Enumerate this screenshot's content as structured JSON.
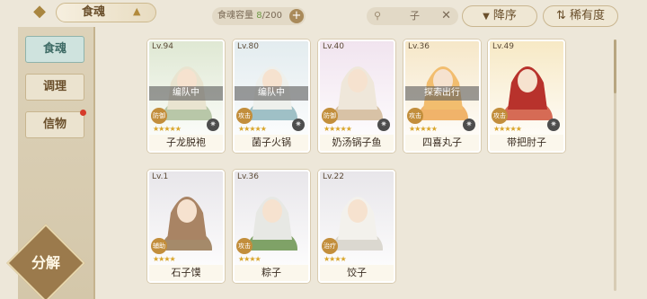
{
  "header": {
    "back_icon": "back-arrow-icon",
    "title": "食魂",
    "capacity_label": "食魂容量",
    "capacity_count": "8",
    "capacity_total": "/200",
    "search_value": "子",
    "sort_label": "降序",
    "rarity_label": "稀有度"
  },
  "sidebar": {
    "tabs": [
      {
        "label": "食魂",
        "active": true
      },
      {
        "label": "调理",
        "active": false
      },
      {
        "label": "信物",
        "active": false
      }
    ],
    "decompose_label": "分解"
  },
  "cards": [
    {
      "level": "Lv.94",
      "name": "子龙脱袍",
      "status": "编队中",
      "type": "防御",
      "stars": "★★★★★",
      "bg": "#dfe8d3",
      "accent": "#b8c7a8",
      "hair": "#e9e4d0"
    },
    {
      "level": "Lv.80",
      "name": "菌子火锅",
      "status": "编队中",
      "type": "攻击",
      "stars": "★★★★★",
      "bg": "#e3ecef",
      "accent": "#9fc0c6",
      "hair": "#eef0ec"
    },
    {
      "level": "Lv.40",
      "name": "奶汤锅子鱼",
      "status": "",
      "type": "防御",
      "stars": "★★★★★",
      "bg": "#f1e4ef",
      "accent": "#d8c2a6",
      "hair": "#efe7da"
    },
    {
      "level": "Lv.36",
      "name": "四喜丸子",
      "status": "探索出行",
      "type": "攻击",
      "stars": "★★★★★",
      "bg": "#f6e7c8",
      "accent": "#f0b36a",
      "hair": "#f2bd6e"
    },
    {
      "level": "Lv.49",
      "name": "带把肘子",
      "status": "",
      "type": "攻击",
      "stars": "★★★★★",
      "bg": "#f7e9c5",
      "accent": "#d66b55",
      "hair": "#b8322c"
    },
    {
      "level": "Lv.1",
      "name": "石子馍",
      "status": "",
      "type": "辅助",
      "stars": "★★★★",
      "bg": "#e8e6ea",
      "accent": "#a58a6a",
      "hair": "#a98464"
    },
    {
      "level": "Lv.36",
      "name": "粽子",
      "status": "",
      "type": "攻击",
      "stars": "★★★★",
      "bg": "#e8e6ea",
      "accent": "#7fa267",
      "hair": "#e7e8e4"
    },
    {
      "level": "Lv.22",
      "name": "饺子",
      "status": "",
      "type": "治疗",
      "stars": "★★★★",
      "bg": "#e8e6ea",
      "accent": "#dbd8d0",
      "hair": "#f3f1ec"
    }
  ]
}
